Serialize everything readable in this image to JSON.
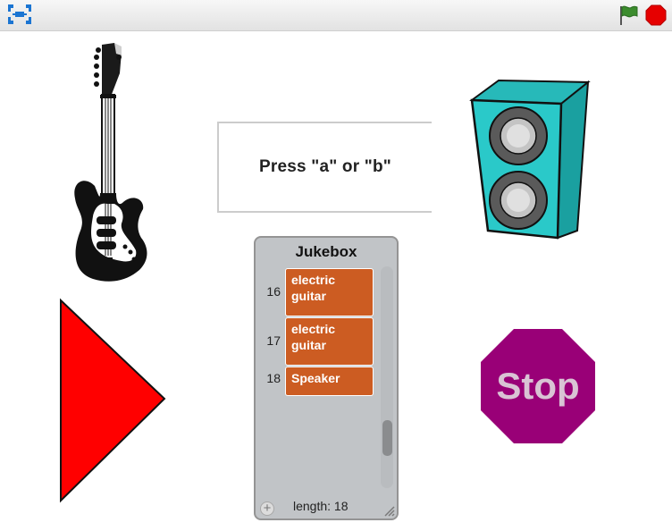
{
  "toolbar": {
    "fullscreen_icon": "fullscreen-icon",
    "green_flag_icon": "green-flag-icon",
    "stop_icon": "stop-icon",
    "green_flag_color": "#3c8c2e",
    "stop_color": "#e60000"
  },
  "stage": {
    "say_bubble": {
      "text": "Press \"a\" or \"b\""
    },
    "stop_sign": {
      "text": "Stop",
      "color": "#990077"
    },
    "play_triangle": {
      "color": "#ff0000"
    },
    "speaker": {
      "color": "#2ac9c9"
    }
  },
  "list_monitor": {
    "title": "Jukebox",
    "items": [
      {
        "index": "16",
        "value": "electric guitar"
      },
      {
        "index": "17",
        "value": "electric guitar"
      },
      {
        "index": "18",
        "value": "Speaker"
      }
    ],
    "add_label": "+",
    "length_label": "length: 18",
    "item_color": "#cc5c22"
  }
}
